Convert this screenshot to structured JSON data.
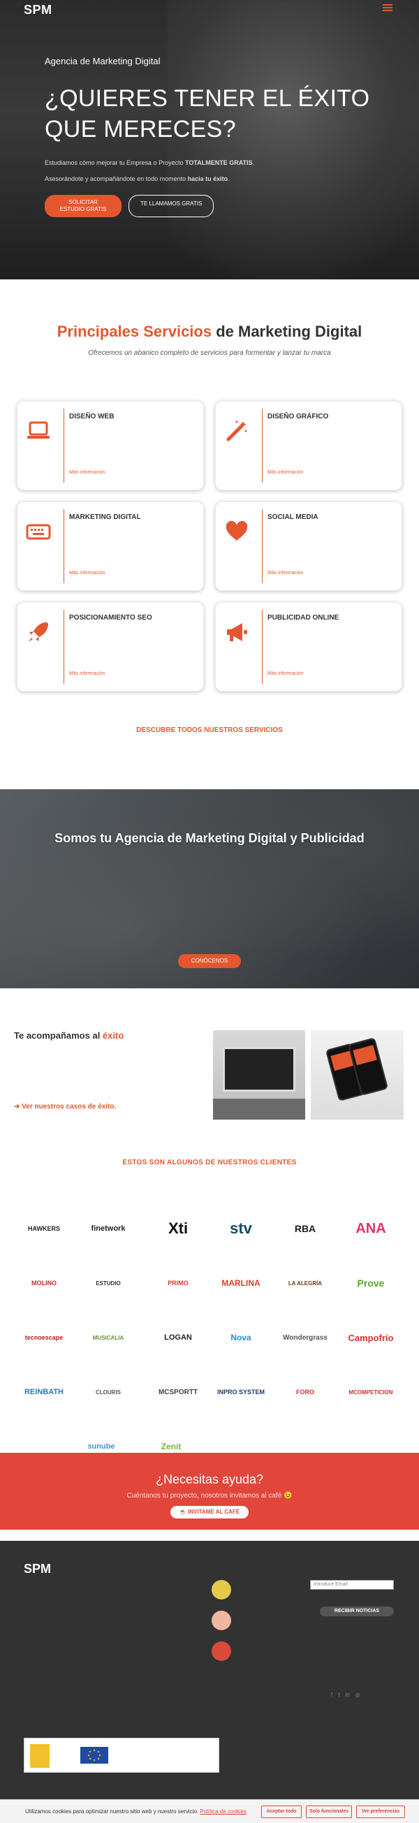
{
  "header": {
    "logo": "SPM"
  },
  "hero": {
    "kicker": "Agencia de Marketing Digital",
    "title": "¿QUIERES TENER EL ÉXITO QUE MERECES?",
    "text1_a": "Estudiamos cómo mejorar tu Empresa o Proyecto ",
    "text1_b": "TOTALMENTE GRATIS",
    "text1_c": ".",
    "text2_a": "Asesorándote y acompañándote en todo momento ",
    "text2_b": "hacia tu éxito",
    "text2_c": ".",
    "btn_primary": "SOLICITAR ESTUDIO GRATIS",
    "btn_secondary": "TE LLAMAMOS GRATIS"
  },
  "services": {
    "title_a": "Principales Servicios",
    "title_b": " de Marketing Digital",
    "subtitle": "Ofrecemos un abanico completo de servicios para formentar y lanzar tu marca",
    "more_label": "Más información",
    "all_label": "DESCUBRE TODOS NUESTROS SERVICIOS",
    "cards": [
      {
        "title": "DISEÑO WEB"
      },
      {
        "title": "DISEÑO GRÁFICO"
      },
      {
        "title": "MARKETING DIGITAL"
      },
      {
        "title": "SOCIAL MEDIA"
      },
      {
        "title": "POSICIONAMIENTO SEO"
      },
      {
        "title": "PUBLICIDAD ONLINE"
      }
    ]
  },
  "agency": {
    "title": "Somos tu Agencia de Marketing Digital y Publicidad",
    "btn": "CONÓCENOS"
  },
  "accompany": {
    "title_a": "Te acompañamos al ",
    "title_b": "éxito",
    "link": "Ver nuestros casos de éxito."
  },
  "clients": {
    "title": "ESTOS SON ALGUNOS DE NUESTROS CLIENTES",
    "logos": [
      "HAWKERS",
      "finetwork",
      "Xti",
      "stv",
      "RBA",
      "ANA",
      "MOLINO",
      "ESTUDIO",
      "PRIMO",
      "MARLINA",
      "LA ALEGRÍA",
      "Prove",
      "tecnoescape",
      "MUSICALIA",
      "LOGAN",
      "Nova",
      "Wondergrass",
      "Campofrío",
      "REINBATH",
      "CLOURIS",
      "MCSPORTT",
      "INPRO SYSTEM",
      "FORO",
      "MCOMPETICION",
      "sunube",
      "Zenit"
    ]
  },
  "help": {
    "title": "¿Necesitas ayuda?",
    "text": "Cuéntanos tu proyecto, nosotros invitamos al café 😉",
    "btn": "☕ INVITAME AL CAFÉ"
  },
  "footer": {
    "logo": "SPM",
    "email_placeholder": "Introduce Email",
    "subscribe_btn": "RECIBIR NOTICIAS"
  },
  "cookie": {
    "text": "Utilizamos cookies para optimizar nuestro sitio web y nuestro servicio.",
    "policy": "Política de cookies",
    "btn_accept": "Aceptar todo",
    "btn_func": "Solo funcionales",
    "btn_prefs": "Ver preferencias"
  }
}
